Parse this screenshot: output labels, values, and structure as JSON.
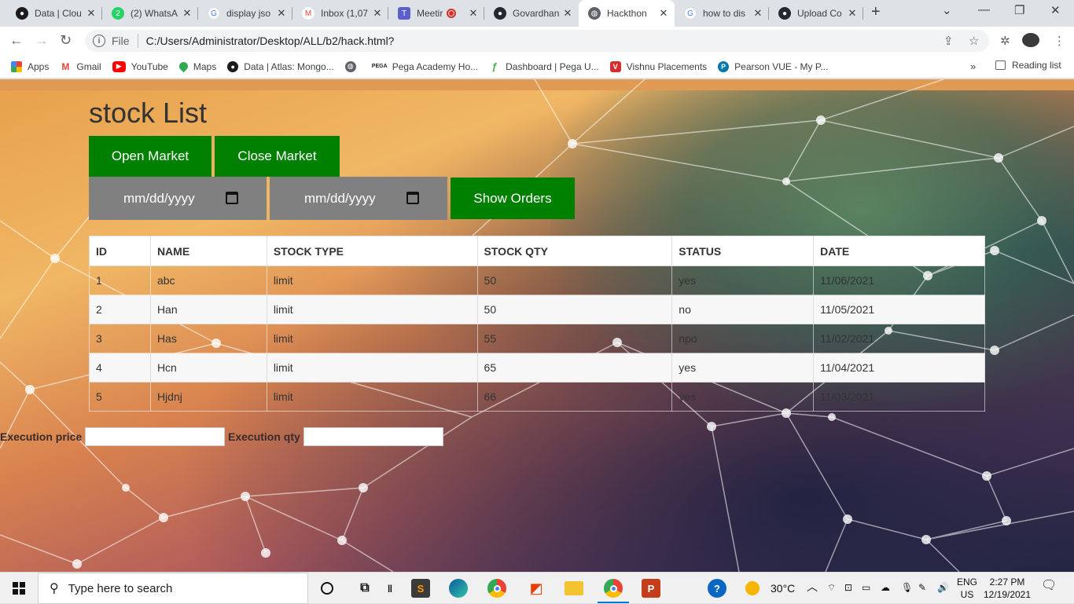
{
  "browser": {
    "tabs": [
      {
        "title": "Data | Clou",
        "favicon": "mongodb-leaf-icon",
        "color": "#13aa52"
      },
      {
        "title": "(2) WhatsA",
        "favicon": "whatsapp-icon",
        "color": "#25d366"
      },
      {
        "title": "display jso",
        "favicon": "google-icon",
        "color": "#4285f4"
      },
      {
        "title": "Inbox (1,07",
        "favicon": "gmail-icon",
        "color": "#ea4335"
      },
      {
        "title": "Meetir",
        "favicon": "teams-icon",
        "color": "#5b5fc7"
      },
      {
        "title": "Govardhan",
        "favicon": "github-icon",
        "color": "#24292f"
      },
      {
        "title": "Hackthon",
        "favicon": "globe-icon",
        "color": "#5f6368"
      },
      {
        "title": "how to dis",
        "favicon": "google-icon",
        "color": "#4285f4"
      },
      {
        "title": "Upload Co",
        "favicon": "github-icon",
        "color": "#24292f"
      }
    ],
    "active_tab_index": 6,
    "address": {
      "scheme": "File",
      "url": "C:/Users/Administrator/Desktop/ALL/b2/hack.html?"
    },
    "bookmarks": [
      {
        "label": "Apps",
        "icon": "apps-grid-icon",
        "color": "#4285f4"
      },
      {
        "label": "Gmail",
        "icon": "gmail-icon",
        "color": "#ea4335"
      },
      {
        "label": "YouTube",
        "icon": "youtube-icon",
        "color": "#ff0000"
      },
      {
        "label": "Maps",
        "icon": "maps-pin-icon",
        "color": "#34a853"
      },
      {
        "label": "Data | Atlas: Mongo...",
        "icon": "mongodb-leaf-icon",
        "color": "#13aa52"
      },
      {
        "label": "",
        "icon": "globe-icon",
        "color": "#5f6368"
      },
      {
        "label": "Pega Academy Ho...",
        "icon": "pega-icon",
        "color": "#222222"
      },
      {
        "label": "Dashboard | Pega U...",
        "icon": "pega-u-icon",
        "color": "#4caf50"
      },
      {
        "label": "Vishnu Placements",
        "icon": "vishnu-icon",
        "color": "#d32f2f"
      },
      {
        "label": "Pearson VUE - My P...",
        "icon": "pearson-icon",
        "color": "#0078a8"
      }
    ],
    "reading_list": "Reading list"
  },
  "page": {
    "title": "stock List",
    "open_market": "Open Market",
    "close_market": "Close Market",
    "date_from_placeholder": "mm/dd/yyyy",
    "date_to_placeholder": "mm/dd/yyyy",
    "show_orders": "Show Orders",
    "table": {
      "headers": [
        "ID",
        "NAME",
        "STOCK TYPE",
        "STOCK QTY",
        "STATUS",
        "DATE"
      ],
      "rows": [
        [
          "1",
          "abc",
          "limit",
          "50",
          "yes",
          "11/06/2021"
        ],
        [
          "2",
          "Han",
          "limit",
          "50",
          "no",
          "11/05/2021"
        ],
        [
          "3",
          "Has",
          "limit",
          "55",
          "npo",
          "11/02/2021"
        ],
        [
          "4",
          "Hcn",
          "limit",
          "65",
          "yes",
          "11/04/2021"
        ],
        [
          "5",
          "Hjdnj",
          "limit",
          "66",
          "yes",
          "11/03/2021"
        ]
      ]
    },
    "execution_price_label": "Execution price",
    "execution_qty_label": "Execution qty"
  },
  "taskbar": {
    "search_placeholder": "Type here to search",
    "weather": "30°C",
    "language": "ENG",
    "region": "US",
    "time": "2:27 PM",
    "date": "12/19/2021"
  }
}
